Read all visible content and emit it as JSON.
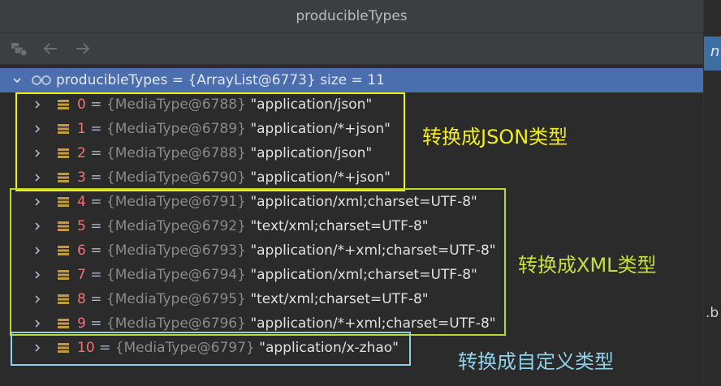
{
  "window": {
    "title": "producibleTypes"
  },
  "toolbar": {
    "icons": [
      "frames-icon",
      "back-arrow-icon",
      "forward-arrow-icon"
    ]
  },
  "root": {
    "name": "producibleTypes",
    "rest": " = {ArrayList@6773}  size = 11"
  },
  "items": [
    {
      "index": "0",
      "obj": "{MediaType@6788}",
      "value": "\"application/json\""
    },
    {
      "index": "1",
      "obj": "{MediaType@6789}",
      "value": "\"application/*+json\""
    },
    {
      "index": "2",
      "obj": "{MediaType@6788}",
      "value": "\"application/json\""
    },
    {
      "index": "3",
      "obj": "{MediaType@6790}",
      "value": "\"application/*+json\""
    },
    {
      "index": "4",
      "obj": "{MediaType@6791}",
      "value": "\"application/xml;charset=UTF-8\""
    },
    {
      "index": "5",
      "obj": "{MediaType@6792}",
      "value": "\"text/xml;charset=UTF-8\""
    },
    {
      "index": "6",
      "obj": "{MediaType@6793}",
      "value": "\"application/*+xml;charset=UTF-8\""
    },
    {
      "index": "7",
      "obj": "{MediaType@6794}",
      "value": "\"application/xml;charset=UTF-8\""
    },
    {
      "index": "8",
      "obj": "{MediaType@6795}",
      "value": "\"text/xml;charset=UTF-8\""
    },
    {
      "index": "9",
      "obj": "{MediaType@6796}",
      "value": "\"application/*+xml;charset=UTF-8\""
    },
    {
      "index": "10",
      "obj": "{MediaType@6797}",
      "value": "\"application/x-zhao\""
    }
  ],
  "annotations": {
    "json": "转换成JSON类型",
    "xml": "转换成XML类型",
    "custom": "转换成自定义类型"
  },
  "right_strip": {
    "tab_text": "n",
    "fragment": ".b"
  },
  "colors": {
    "json_box": "#f2ee1c",
    "xml_box": "#b9dc2c",
    "custom_box": "#8fd0ea",
    "json_text": "#f2ee1c",
    "xml_text": "#c4e03a",
    "custom_text": "#8fd0ea"
  }
}
